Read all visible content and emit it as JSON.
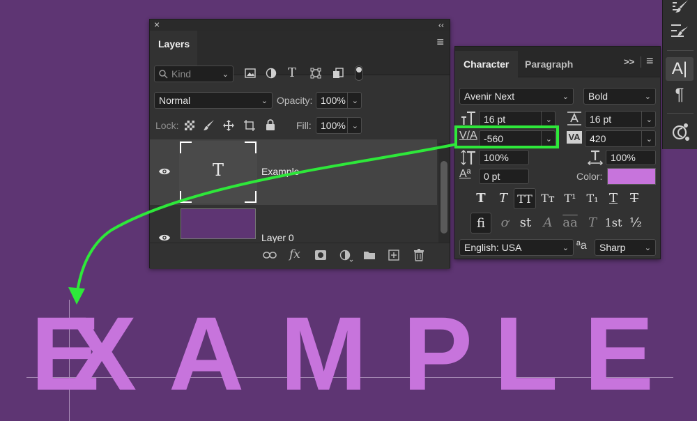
{
  "canvas": {
    "letters": [
      "E",
      "X",
      "A",
      "M",
      "P",
      "L",
      "E"
    ],
    "text_color": "#c774dc",
    "background": "#5e3573"
  },
  "layers_panel": {
    "close_glyph": "×",
    "collapse_glyph": "‹‹",
    "tab_label": "Layers",
    "menu_glyph": "≡",
    "filter": {
      "kind_label": "Kind"
    },
    "blend_mode": "Normal",
    "opacity_label": "Opacity:",
    "opacity_value": "100%",
    "lock_label": "Lock:",
    "fill_label": "Fill:",
    "fill_value": "100%",
    "layers": [
      {
        "name": "Example",
        "thumb_glyph": "T",
        "selected": true
      },
      {
        "name": "Layer 0",
        "thumb_color": "#5e3573",
        "selected": false
      }
    ],
    "footer_fx": "fx"
  },
  "character_panel": {
    "tabs": [
      "Character",
      "Paragraph"
    ],
    "expand_glyph": ">>",
    "menu_glyph": "≡",
    "font_family": "Avenir Next",
    "font_style": "Bold",
    "font_size": "16 pt",
    "leading": "16 pt",
    "kerning_label": "V/A",
    "kerning": "-560",
    "tracking_label": "VA",
    "tracking": "420",
    "vertical_scale": "100%",
    "horizontal_scale": "100%",
    "baseline_shift_label": "Aª",
    "baseline_shift": "0 pt",
    "color_label": "Color:",
    "color_value": "#c774dc",
    "style_buttons": [
      "T",
      "T",
      "TT",
      "Tт",
      "T¹",
      "T₁",
      "T",
      "T"
    ],
    "opentype_buttons": [
      "fi",
      "ơ",
      "st",
      "A",
      "aa",
      "T",
      "1st",
      "½"
    ],
    "language": "English: USA",
    "aa_label": "ªa",
    "antialias": "Sharp"
  },
  "annotation": {
    "highlight_color": "#2ee83a"
  },
  "toolstrip": {
    "character_glyph": "A|",
    "paragraph_glyph": "¶"
  }
}
